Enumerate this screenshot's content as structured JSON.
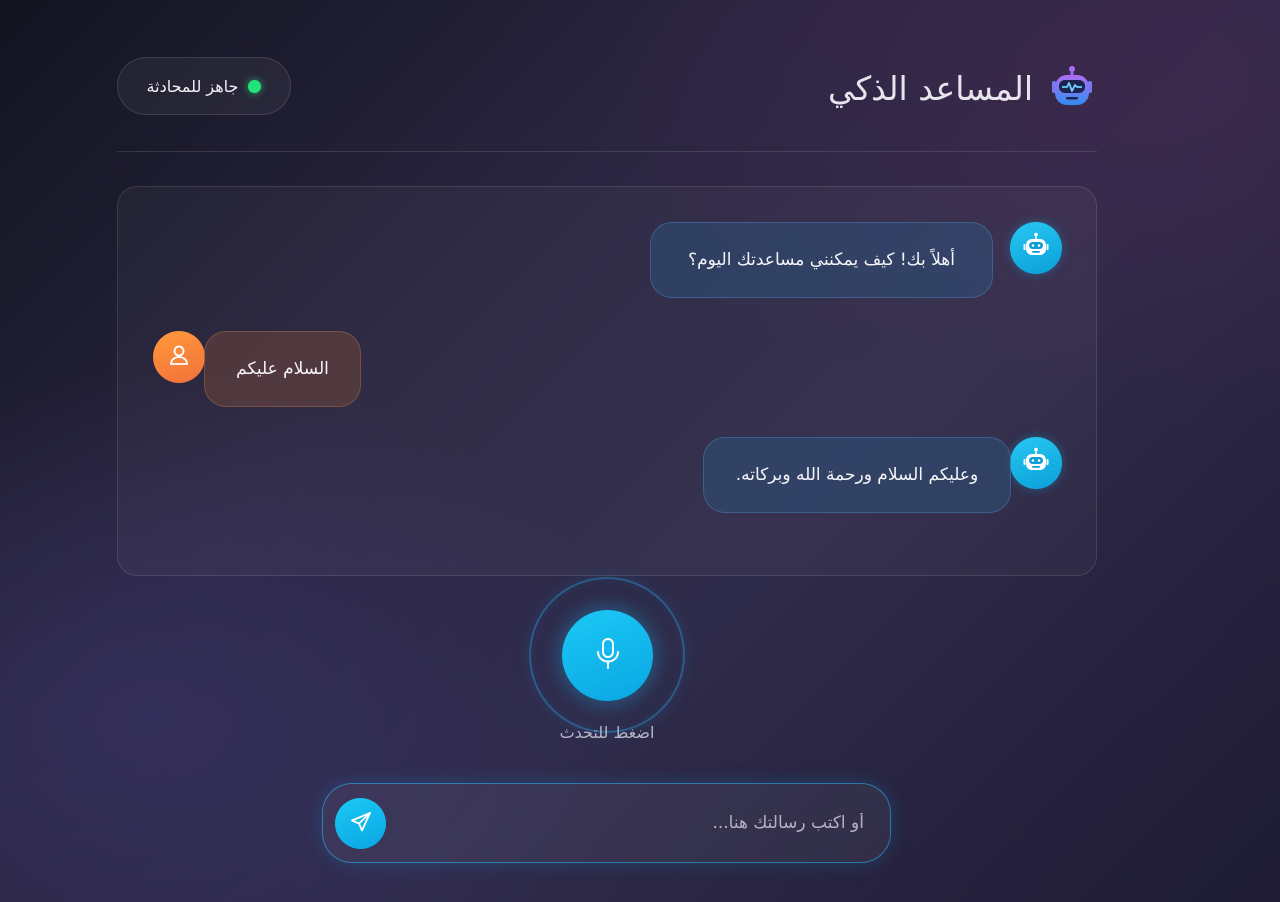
{
  "header": {
    "title": "المساعد الذكي",
    "brand_icon": "robot-icon",
    "status": {
      "text": "جاهز للمحادثة",
      "color": "#22e27a"
    }
  },
  "chat": {
    "messages": [
      {
        "sender": "bot",
        "text": "أهلاً بك! كيف يمكنني مساعدتك اليوم؟",
        "avatar_icon": "robot-icon"
      },
      {
        "sender": "user",
        "text": "السلام عليكم",
        "avatar_icon": "user-icon"
      },
      {
        "sender": "bot",
        "text": "وعليكم السلام ورحمة الله وبركاته.",
        "avatar_icon": "robot-icon"
      }
    ]
  },
  "voice": {
    "label": "اضغط للتحدث",
    "icon": "microphone-icon"
  },
  "composer": {
    "placeholder": "أو اكتب رسالتك هنا...",
    "value": "",
    "send_icon": "send-icon"
  },
  "colors": {
    "accent": "#12b8ee",
    "user_accent": "#f7843a",
    "status_online": "#22e27a"
  }
}
